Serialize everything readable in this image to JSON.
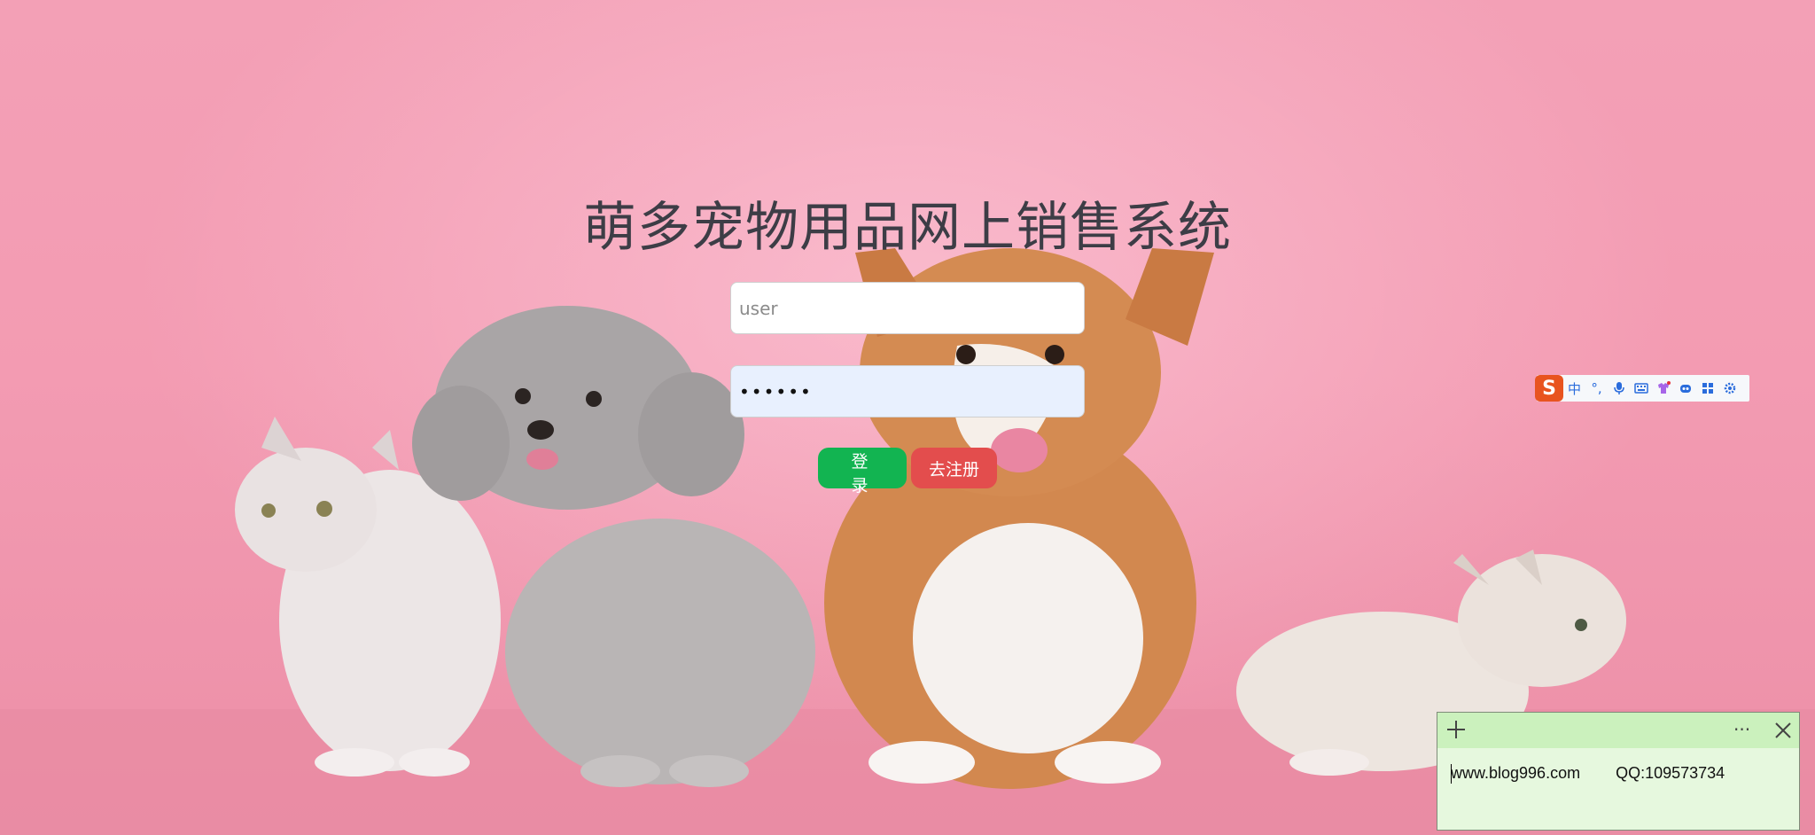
{
  "title": "萌多宠物用品网上销售系统",
  "login_form": {
    "username_placeholder": "user",
    "password_value": "••••••",
    "login_label": "登 录",
    "register_label": "去注册"
  },
  "ime_toolbar": {
    "logo": "S",
    "lang_label": "中",
    "punct_label": "°,",
    "icons": [
      "sogou-logo-icon",
      "chinese-mode-icon",
      "punctuation-icon",
      "microphone-icon",
      "keyboard-icon",
      "skin-icon",
      "emoji-robot-icon",
      "apps-grid-icon",
      "settings-gear-icon"
    ]
  },
  "sticky_note": {
    "text": "www.blog996.com        QQ:109573734",
    "more_label": "···"
  },
  "colors": {
    "background_pink": "#f39bb2",
    "title_color": "#3d3d46",
    "login_button": "#12b451",
    "register_button": "#e34d4d",
    "password_fill": "#e8f0fe",
    "note_background": "#e6f8de",
    "note_header": "#cbf1bd",
    "ime_accent": "#2a6cdc",
    "ime_logo": "#e8541f"
  }
}
